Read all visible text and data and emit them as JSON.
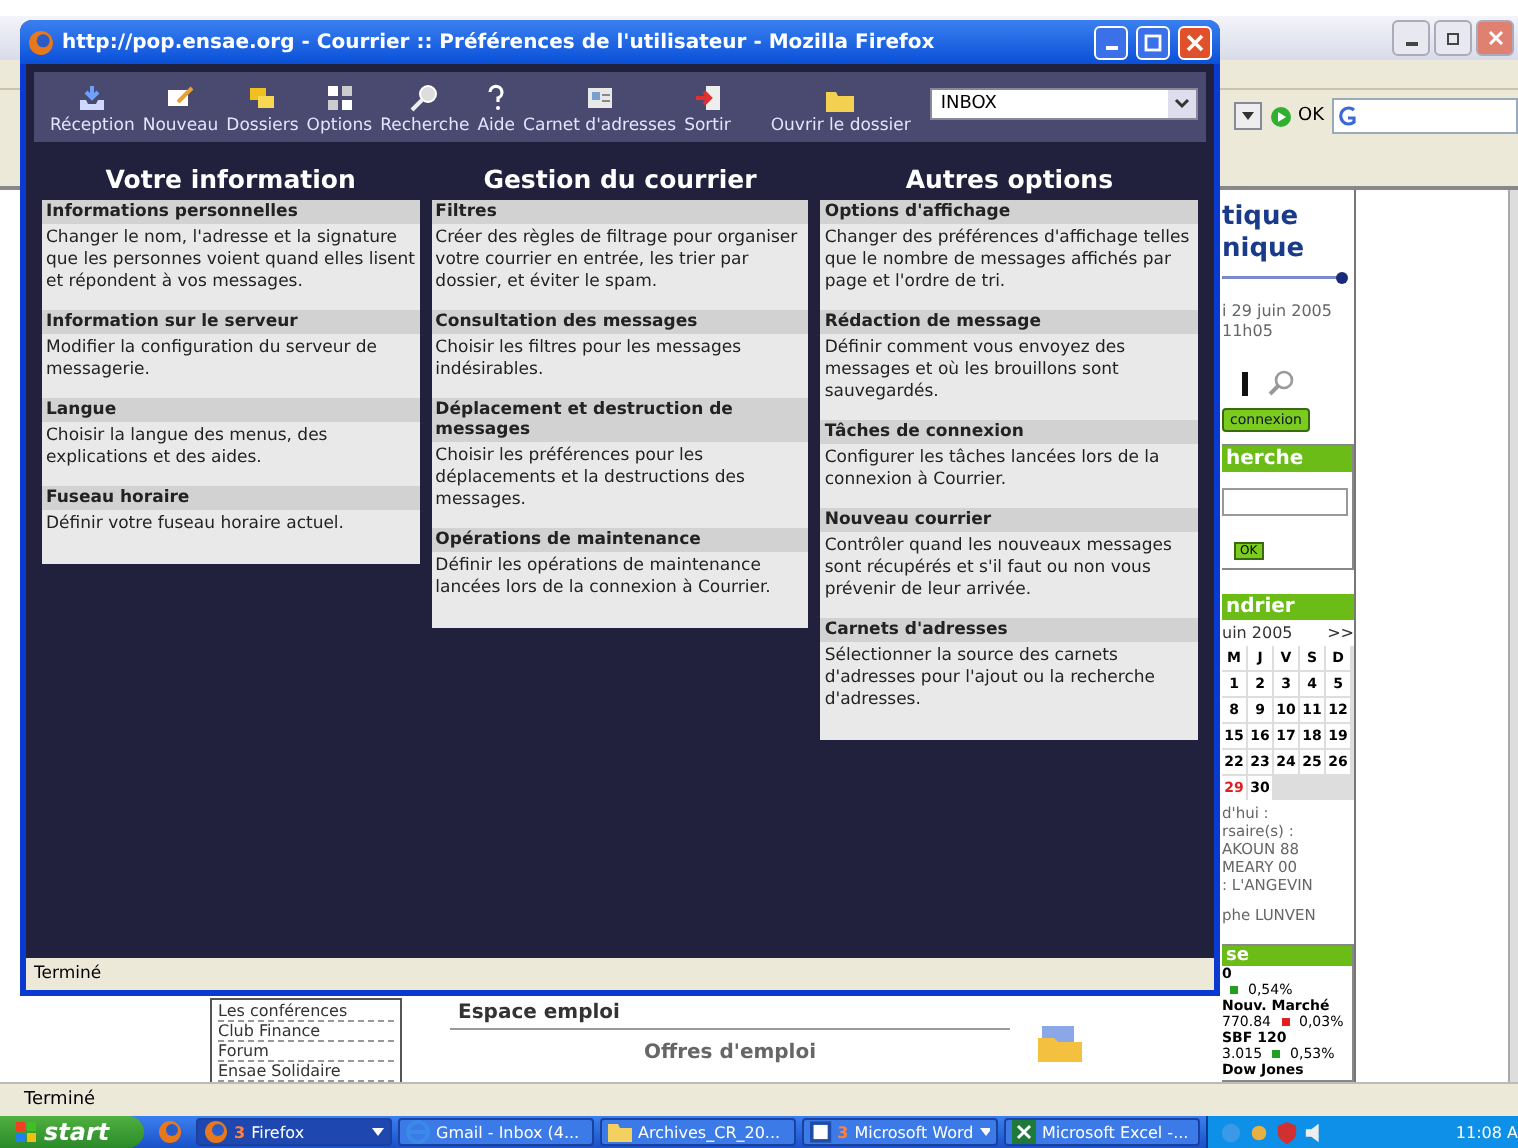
{
  "back_window": {
    "toolbar": {
      "go_label": "OK"
    },
    "page": {
      "heading_lines": [
        "tique",
        "nique"
      ],
      "date_lines": [
        "i 29 juin 2005",
        "11h05"
      ],
      "login_button": "connexion",
      "search_panel": {
        "title": "herche",
        "button": "OK"
      },
      "calendar": {
        "title": "ndrier",
        "month": "uin 2005",
        "next": ">>",
        "weekdays": [
          "M",
          "J",
          "V",
          "S",
          "D"
        ],
        "weeks": [
          [
            {
              "label": "1",
              "today": false
            },
            {
              "label": "2",
              "today": false
            },
            {
              "label": "3",
              "today": false
            },
            {
              "label": "4",
              "today": false
            },
            {
              "label": "5",
              "today": false
            }
          ],
          [
            {
              "label": "8",
              "today": false
            },
            {
              "label": "9",
              "today": false
            },
            {
              "label": "10",
              "today": false
            },
            {
              "label": "11",
              "today": false
            },
            {
              "label": "12",
              "today": false
            }
          ],
          [
            {
              "label": "15",
              "today": false
            },
            {
              "label": "16",
              "today": false
            },
            {
              "label": "17",
              "today": false
            },
            {
              "label": "18",
              "today": false
            },
            {
              "label": "19",
              "today": false
            }
          ],
          [
            {
              "label": "22",
              "today": false
            },
            {
              "label": "23",
              "today": false
            },
            {
              "label": "24",
              "today": false
            },
            {
              "label": "25",
              "today": false
            },
            {
              "label": "26",
              "today": false
            }
          ],
          [
            {
              "label": "29",
              "today": true
            },
            {
              "label": "30",
              "today": false
            }
          ]
        ]
      },
      "today_lines": [
        "d'hui :",
        "rsaire(s) :",
        "AKOUN 88",
        "MEARY 00",
        ": L'ANGEVIN",
        "phe LUNVEN"
      ],
      "bourse": {
        "title": "se",
        "rows": [
          {
            "name": "0",
            "change": "0,54%",
            "color": "#20a020"
          },
          {
            "name": "Nouv. Marché",
            "value": "770.84",
            "change": "0,03%",
            "color": "#e02020"
          },
          {
            "name": "SBF 120",
            "value": "3.015",
            "change": "0,53%",
            "color": "#20a020"
          },
          {
            "name": "Dow Jones"
          }
        ]
      },
      "links": [
        "Les conférences",
        "Club Finance",
        "Forum",
        "Ensae Solidaire"
      ],
      "emploi": {
        "title": "Espace emploi",
        "link": "Offres d'emploi"
      }
    },
    "status": "Terminé"
  },
  "front_window": {
    "title": "http://pop.ensae.org - Courrier :: Préférences de l'utilisateur - Mozilla Firefox",
    "toolbar": [
      {
        "label": "Réception",
        "kind": "inbox"
      },
      {
        "label": "Nouveau",
        "kind": "compose"
      },
      {
        "label": "Dossiers",
        "kind": "folders"
      },
      {
        "label": "Options",
        "kind": "options"
      },
      {
        "label": "Recherche",
        "kind": "search"
      },
      {
        "label": "Aide",
        "kind": "help"
      },
      {
        "label": "Carnet d'adresses",
        "kind": "addressbook"
      },
      {
        "label": "Sortir",
        "kind": "logout"
      }
    ],
    "open_folder": "Ouvrir le dossier",
    "folder_select": "INBOX",
    "columns": [
      {
        "title": "Votre information",
        "sections": [
          {
            "heading": "Informations personnelles",
            "text": "Changer le nom, l'adresse et la signature que les personnes voient quand elles lisent et répondent à vos messages."
          },
          {
            "heading": "Information sur le serveur",
            "text": "Modifier la configuration du serveur de messagerie."
          },
          {
            "heading": "Langue",
            "text": "Choisir la langue des menus, des explications et des aides."
          },
          {
            "heading": "Fuseau horaire",
            "text": "Définir votre fuseau horaire actuel."
          }
        ]
      },
      {
        "title": "Gestion du courrier",
        "sections": [
          {
            "heading": "Filtres",
            "text": "Créer des règles de filtrage pour organiser votre courrier en entrée, les trier par dossier, et éviter le spam."
          },
          {
            "heading": "Consultation des messages",
            "text": "Choisir les filtres pour les messages indésirables."
          },
          {
            "heading": "Déplacement et destruction de messages",
            "text": "Choisir les préférences pour les déplacements et la destructions des messages."
          },
          {
            "heading": "Opérations de maintenance",
            "text": "Définir les opérations de maintenance lancées lors de la connexion à Courrier."
          }
        ]
      },
      {
        "title": "Autres options",
        "sections": [
          {
            "heading": "Options d'affichage",
            "text": "Changer des préférences d'affichage telles que le nombre de messages affichés par page et l'ordre de tri."
          },
          {
            "heading": "Rédaction de message",
            "text": "Définir comment vous envoyez des messages et où les brouillons sont sauvegardés."
          },
          {
            "heading": "Tâches de connexion",
            "text": "Configurer les tâches lancées lors de la connexion à Courrier."
          },
          {
            "heading": "Nouveau courrier",
            "text": "Contrôler quand les nouveaux messages sont récupérés et s'il faut ou non vous prévenir de leur arrivée."
          },
          {
            "heading": "Carnets d'adresses",
            "text": "Sélectionner la source des carnets d'adresses pour l'ajout ou la recherche d'adresses."
          }
        ]
      }
    ],
    "status": "Terminé"
  },
  "taskbar": {
    "start": "start",
    "tasks": [
      {
        "label": "Firefox",
        "badge": "3",
        "kind": "browser",
        "grouped": true,
        "selected": true
      },
      {
        "label": "Gmail - Inbox (4...",
        "kind": "ie",
        "grouped": false,
        "selected": false
      },
      {
        "label": "Archives_CR_20...",
        "kind": "folder",
        "grouped": false,
        "selected": false
      },
      {
        "label": "Microsoft Word",
        "badge": "3",
        "kind": "word",
        "grouped": true,
        "selected": false
      },
      {
        "label": "Microsoft Excel -...",
        "kind": "excel",
        "grouped": false,
        "selected": false
      }
    ],
    "clock": "11:08 A"
  }
}
